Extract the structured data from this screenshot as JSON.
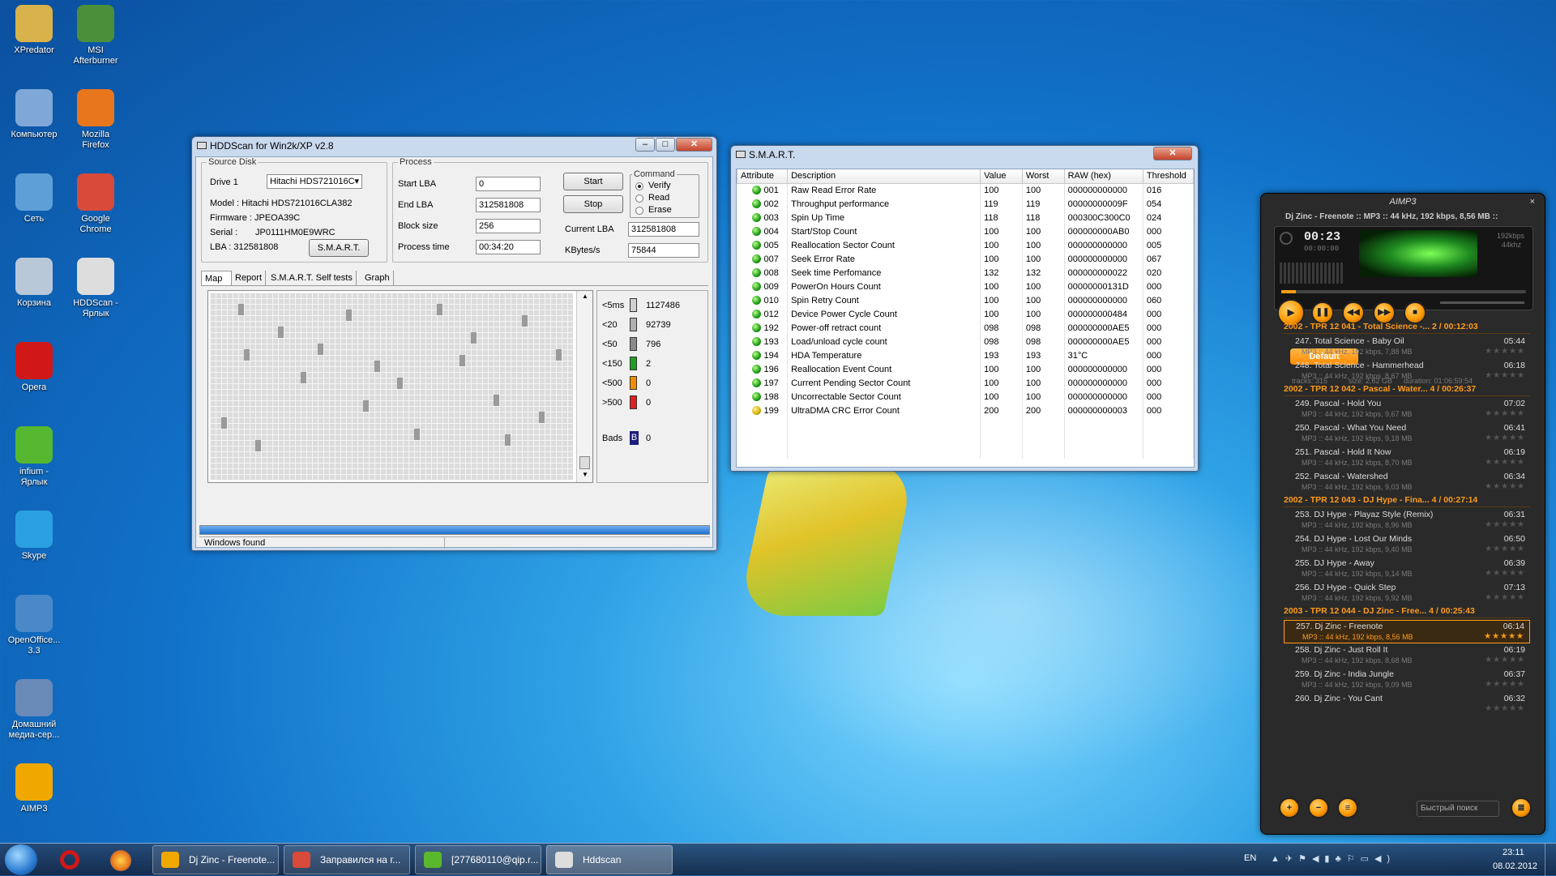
{
  "desktop": {
    "icons": [
      {
        "label": "XPredator",
        "name": "xpredator-icon",
        "color": "#d8b24a"
      },
      {
        "label": "MSI\nAfterburner",
        "name": "msi-afterburner-icon",
        "color": "#4b8f3a"
      },
      {
        "label": "Компьютер",
        "name": "computer-icon",
        "color": "#7fa8d8"
      },
      {
        "label": "Mozilla\nFirefox",
        "name": "firefox-icon",
        "color": "#e8761c"
      },
      {
        "label": "Сеть",
        "name": "network-icon",
        "color": "#5e9fd8"
      },
      {
        "label": "Google\nChrome",
        "name": "chrome-icon",
        "color": "#d84a3a"
      },
      {
        "label": "Корзина",
        "name": "recycle-bin-icon",
        "color": "#b8c8d8"
      },
      {
        "label": "HDDScan -\nЯрлык",
        "name": "hddscan-shortcut-icon",
        "color": "#dddddd"
      },
      {
        "label": "Opera",
        "name": "opera-icon",
        "color": "#d01818"
      },
      {
        "label": "infium -\nЯрлык",
        "name": "infium-shortcut-icon",
        "color": "#56b830"
      },
      {
        "label": "Skype",
        "name": "skype-icon",
        "color": "#2aa0e0"
      },
      {
        "label": "OpenOffice...\n3.3",
        "name": "openoffice-icon",
        "color": "#4a88c8"
      },
      {
        "label": "Домашний\nмедиа-сер...",
        "name": "media-server-icon",
        "color": "#6a8ab8"
      },
      {
        "label": "AIMP3",
        "name": "aimp3-icon",
        "color": "#f0a800"
      }
    ]
  },
  "hddscan": {
    "title": "HDDScan for Win2k/XP  v2.8",
    "source_disk": {
      "group": "Source Disk",
      "drive_label": "Drive 1",
      "drive_value": "Hitachi HDS721016C",
      "model": "Model : Hitachi HDS721016CLA382",
      "firmware": "Firmware : JPEOA39C",
      "serial_label": "Serial :",
      "serial": "JP0111HM0E9WRC",
      "lba": "LBA :  312581808",
      "smart_button": "S.M.A.R.T."
    },
    "process": {
      "group": "Process",
      "start_lba_label": "Start LBA",
      "start_lba": "0",
      "end_lba_label": "End LBA",
      "end_lba": "312581808",
      "block_size_label": "Block size",
      "block_size": "256",
      "process_time_label": "Process time",
      "process_time": "00:34:20",
      "start_button": "Start",
      "stop_button": "Stop",
      "current_lba_label": "Current LBA",
      "current_lba": "312581808",
      "kbytes_label": "KBytes/s",
      "kbytes": "75844"
    },
    "command": {
      "group": "Command",
      "verify": "Verify",
      "read": "Read",
      "erase": "Erase",
      "selected": "Verify"
    },
    "tabs": [
      "Map",
      "Report",
      "S.M.A.R.T. Self tests",
      "Graph"
    ],
    "legend": [
      {
        "label": "<5ms",
        "value": "1127486",
        "color": "#d0d0d0"
      },
      {
        "label": "<20",
        "value": "92739",
        "color": "#b0b0b0"
      },
      {
        "label": "<50",
        "value": "796",
        "color": "#8a8a8a"
      },
      {
        "label": "<150",
        "value": "2",
        "color": "#20a020"
      },
      {
        "label": "<500",
        "value": "0",
        "color": "#f08c00"
      },
      {
        "label": ">500",
        "value": "0",
        "color": "#e02020"
      }
    ],
    "bads": {
      "label": "Bads",
      "badge": "B",
      "value": "0"
    },
    "progress": 1.0,
    "status": "Windows  found"
  },
  "smart": {
    "title": "S.M.A.R.T.",
    "columns": [
      "Attribute",
      "Description",
      "Value",
      "Worst",
      "RAW (hex)",
      "Threshold"
    ],
    "rows": [
      [
        "001",
        "Raw Read Error Rate",
        "100",
        "100",
        "000000000000",
        "016",
        "ok"
      ],
      [
        "002",
        "Throughput performance",
        "119",
        "119",
        "00000000009F",
        "054",
        "ok"
      ],
      [
        "003",
        "Spin Up Time",
        "118",
        "118",
        "000300C300C0",
        "024",
        "ok"
      ],
      [
        "004",
        "Start/Stop Count",
        "100",
        "100",
        "000000000AB0",
        "000",
        "ok"
      ],
      [
        "005",
        "Reallocation Sector Count",
        "100",
        "100",
        "000000000000",
        "005",
        "ok"
      ],
      [
        "007",
        "Seek Error Rate",
        "100",
        "100",
        "000000000000",
        "067",
        "ok"
      ],
      [
        "008",
        "Seek time Perfomance",
        "132",
        "132",
        "000000000022",
        "020",
        "ok"
      ],
      [
        "009",
        "PowerOn Hours Count",
        "100",
        "100",
        "00000000131D",
        "000",
        "ok"
      ],
      [
        "010",
        "Spin Retry Count",
        "100",
        "100",
        "000000000000",
        "060",
        "ok"
      ],
      [
        "012",
        "Device Power Cycle Count",
        "100",
        "100",
        "000000000484",
        "000",
        "ok"
      ],
      [
        "192",
        "Power-off retract count",
        "098",
        "098",
        "000000000AE5",
        "000",
        "ok"
      ],
      [
        "193",
        "Load/unload cycle count",
        "098",
        "098",
        "000000000AE5",
        "000",
        "ok"
      ],
      [
        "194",
        "HDA Temperature",
        "193",
        "193",
        "31°C",
        "000",
        "ok"
      ],
      [
        "196",
        "Reallocation Event Count",
        "100",
        "100",
        "000000000000",
        "000",
        "ok"
      ],
      [
        "197",
        "Current Pending Sector Count",
        "100",
        "100",
        "000000000000",
        "000",
        "ok"
      ],
      [
        "198",
        "Uncorrectable Sector Count",
        "100",
        "100",
        "000000000000",
        "000",
        "ok"
      ],
      [
        "199",
        "UltraDMA CRC Error Count",
        "200",
        "200",
        "000000000003",
        "000",
        "warn"
      ]
    ]
  },
  "aimp": {
    "title": "AIMP3",
    "now_playing": "Dj Zinc - Freenote :: MP3 :: 44 kHz, 192 kbps, 8,56 MB ::",
    "time": "00:23",
    "time_sub": "00:00:00",
    "bitrate": "192kbps",
    "samplerate": "44khz",
    "playlist_tab": "Default",
    "stats": {
      "tracks": "tracks: 315",
      "size": "size: 2,62 GB",
      "duration": "duration: 01:06:59:54"
    },
    "groups": [
      {
        "header": "2002 - TPR 12 041 - Total Science -... 2 / 00:12:03",
        "tracks": [
          {
            "title": "247. Total Science - Baby Oil",
            "dur": "05:44",
            "info": "MP3 :: 44 kHz, 192 kbps, 7,88 MB"
          },
          {
            "title": "248. Total Science - Hammerhead",
            "dur": "06:18",
            "info": "MP3 :: 44 kHz, 192 kbps, 8,67 MB"
          }
        ]
      },
      {
        "header": "2002 - TPR 12 042 - Pascal - Water... 4 / 00:26:37",
        "tracks": [
          {
            "title": "249. Pascal - Hold You",
            "dur": "07:02",
            "info": "MP3 :: 44 kHz, 192 kbps, 9,67 MB"
          },
          {
            "title": "250. Pascal - What You Need",
            "dur": "06:41",
            "info": "MP3 :: 44 kHz, 192 kbps, 9,18 MB"
          },
          {
            "title": "251. Pascal - Hold It Now",
            "dur": "06:19",
            "info": "MP3 :: 44 kHz, 192 kbps, 8,70 MB"
          },
          {
            "title": "252. Pascal - Watershed",
            "dur": "06:34",
            "info": "MP3 :: 44 kHz, 192 kbps, 9,03 MB"
          }
        ]
      },
      {
        "header": "2002 - TPR 12 043 - DJ Hype - Fina... 4 / 00:27:14",
        "tracks": [
          {
            "title": "253. DJ Hype - Playaz Style (Remix)",
            "dur": "06:31",
            "info": "MP3 :: 44 kHz, 192 kbps, 8,96 MB"
          },
          {
            "title": "254. DJ Hype - Lost Our Minds",
            "dur": "06:50",
            "info": "MP3 :: 44 kHz, 192 kbps, 9,40 MB"
          },
          {
            "title": "255. DJ Hype - Away",
            "dur": "06:39",
            "info": "MP3 :: 44 kHz, 192 kbps, 9,14 MB"
          },
          {
            "title": "256. DJ Hype - Quick Step",
            "dur": "07:13",
            "info": "MP3 :: 44 kHz, 192 kbps, 9,92 MB"
          }
        ]
      },
      {
        "header": "2003 - TPR 12 044 - DJ Zinc - Free... 4 / 00:25:43",
        "tracks": [
          {
            "title": "257. Dj Zinc - Freenote",
            "dur": "06:14",
            "info": "MP3 :: 44 kHz, 192 kbps, 8,56 MB",
            "active": true
          },
          {
            "title": "258. Dj Zinc - Just Roll It",
            "dur": "06:19",
            "info": "MP3 :: 44 kHz, 192 kbps, 8,68 MB"
          },
          {
            "title": "259. Dj Zinc - India Jungle",
            "dur": "06:37",
            "info": "MP3 :: 44 kHz, 192 kbps, 9,09 MB"
          },
          {
            "title": "260. Dj Zinc - You Cant",
            "dur": "06:32",
            "info": ""
          }
        ]
      }
    ],
    "search_placeholder": "Быстрый поиск"
  },
  "taskbar": {
    "apps": [
      {
        "label": "Dj Zinc - Freenote...",
        "name": "taskbar-aimp",
        "color": "#f0a800"
      },
      {
        "label": "Заправился на г...",
        "name": "taskbar-chrome",
        "color": "#d84a3a"
      },
      {
        "label": "[277680110@qip.r...",
        "name": "taskbar-qip",
        "color": "#5ab82c"
      },
      {
        "label": "Hddscan",
        "name": "taskbar-hddscan",
        "color": "#dddddd"
      }
    ],
    "lang": "EN",
    "time": "23:11",
    "date": "08.02.2012"
  }
}
